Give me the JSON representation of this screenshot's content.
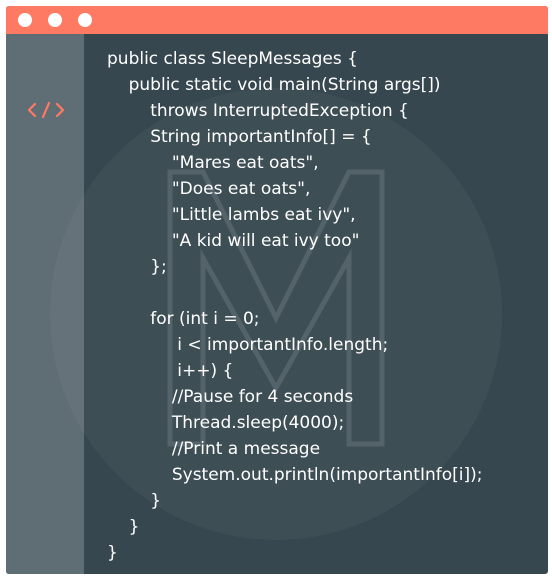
{
  "colors": {
    "titlebar": "#ff7a63",
    "editor_background": "#37474f",
    "gutter": "#5f6d74",
    "text": "#ffffff",
    "icon_accent": "#ff7a63"
  },
  "icons": {
    "gutter": "code-brackets-icon",
    "watermark": "m-logo-watermark"
  },
  "code_lines": [
    "public class SleepMessages {",
    "    public static void main(String args[])",
    "        throws InterruptedException {",
    "        String importantInfo[] = {",
    "            \"Mares eat oats\",",
    "            \"Does eat oats\",",
    "            \"Little lambs eat ivy\",",
    "            \"A kid will eat ivy too\"",
    "        };",
    "",
    "        for (int i = 0;",
    "             i < importantInfo.length;",
    "             i++) {",
    "            //Pause for 4 seconds",
    "            Thread.sleep(4000);",
    "            //Print a message",
    "            System.out.println(importantInfo[i]);",
    "        }",
    "    }",
    "}"
  ]
}
